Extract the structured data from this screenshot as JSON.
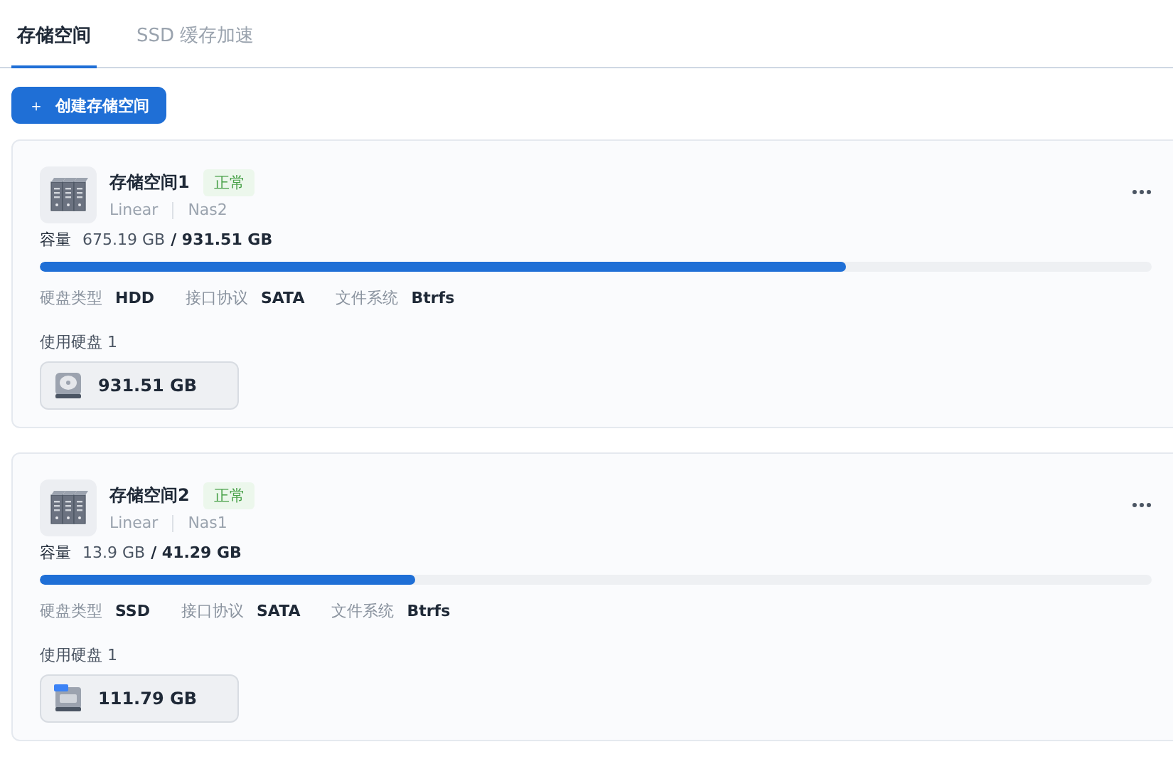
{
  "tabs": [
    {
      "label": "存储空间",
      "selected": true
    },
    {
      "label": "SSD 缓存加速",
      "selected": false
    }
  ],
  "create_button": {
    "icon": "＋",
    "label": "创建存储空间"
  },
  "pools": [
    {
      "name": "存储空间1",
      "status": "正常",
      "raid": "Linear",
      "host": "Nas2",
      "capacity_label": "容量",
      "used": "675.19 GB",
      "total": "/ 931.51 GB",
      "level": 0.725,
      "specs": [
        {
          "label": "硬盘类型",
          "value": "HDD"
        },
        {
          "label": "接口协议",
          "value": "SATA"
        },
        {
          "label": "文件系统",
          "value": "Btrfs"
        }
      ],
      "disks_label": "使用硬盘 1",
      "disks": [
        {
          "kind": "hdd",
          "size": "931.51 GB"
        }
      ]
    },
    {
      "name": "存储空间2",
      "status": "正常",
      "raid": "Linear",
      "host": "Nas1",
      "capacity_label": "容量",
      "used": "13.9 GB",
      "total": "/ 41.29 GB",
      "level": 0.337,
      "specs": [
        {
          "label": "硬盘类型",
          "value": "SSD"
        },
        {
          "label": "接口协议",
          "value": "SATA"
        },
        {
          "label": "文件系统",
          "value": "Btrfs"
        }
      ],
      "disks_label": "使用硬盘 1",
      "disks": [
        {
          "kind": "ssd",
          "size": "111.79 GB"
        }
      ]
    }
  ]
}
